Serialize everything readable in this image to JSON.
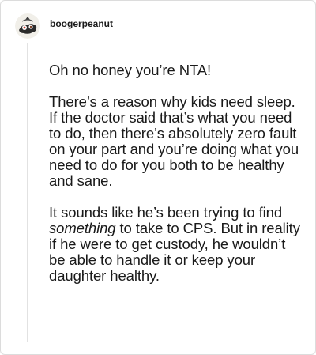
{
  "post": {
    "username": "boogerpeanut",
    "avatar_icon": "avatar-icon",
    "paragraphs": {
      "p1": "Oh no honey you’re NTA!",
      "p2": "There’s a reason why kids need sleep. If the doctor said that’s what you need to do, then there’s absolutely zero fault on your part and you’re doing what you need to do for you both to be healthy and sane.",
      "p3_before": "It sounds like he’s been trying to find ",
      "p3_emphasis": "something",
      "p3_after": " to take to CPS. But in reality if he were to get custody, he wouldn’t be able to handle it or keep your daughter healthy."
    }
  }
}
